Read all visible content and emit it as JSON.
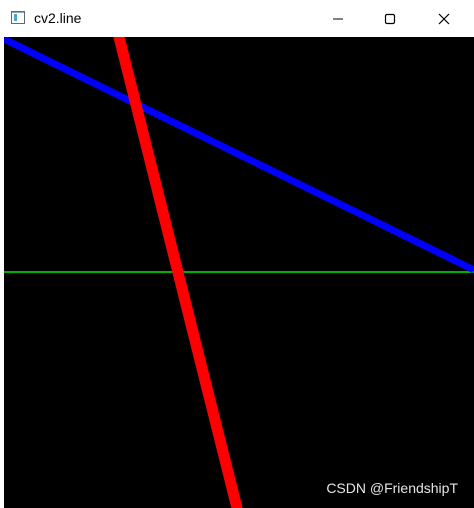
{
  "window": {
    "title": "cv2.line",
    "app_icon": "opencv-window-icon",
    "controls": {
      "minimize": "minimize-icon",
      "maximize": "maximize-icon",
      "close": "close-icon"
    }
  },
  "canvas": {
    "background": "#000000",
    "lines": [
      {
        "name": "blue-line",
        "color": "#0000ff"
      },
      {
        "name": "red-line",
        "color": "#ff0000"
      },
      {
        "name": "green-line",
        "color": "#00b000"
      }
    ],
    "watermark": "CSDN @FriendshipT"
  }
}
